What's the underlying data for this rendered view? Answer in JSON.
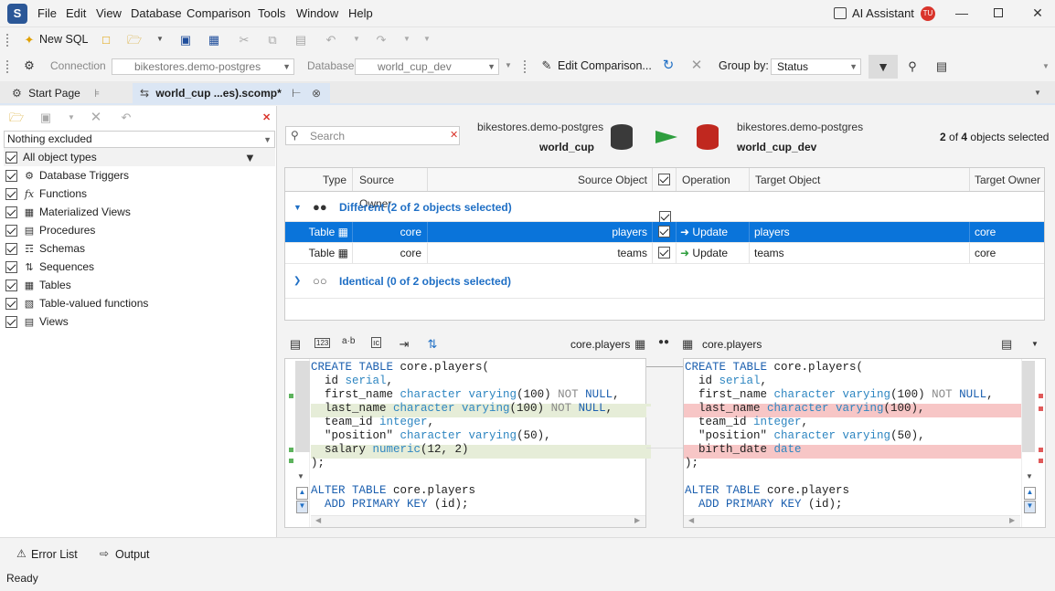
{
  "app": {
    "menu": [
      "File",
      "Edit",
      "View",
      "Database",
      "Comparison",
      "Tools",
      "Window",
      "Help"
    ],
    "ai_assistant": "AI Assistant",
    "user_initials": "TU"
  },
  "toolbar1": {
    "new_sql": "New SQL"
  },
  "toolbar2": {
    "connection_label": "Connection",
    "connection_value": "bikestores.demo-postgres",
    "database_label": "Database",
    "database_value": "world_cup_dev",
    "edit_comparison": "Edit Comparison...",
    "group_by_label": "Group by:",
    "group_by_value": "Status"
  },
  "tabs": [
    {
      "label": "Start Page"
    },
    {
      "label": "world_cup ...es).scomp*"
    }
  ],
  "left_panel": {
    "filter_value": "Nothing excluded",
    "items": [
      {
        "label": "All object types",
        "icon": "all-icon"
      },
      {
        "label": "Database Triggers",
        "icon": "trigger-icon"
      },
      {
        "label": "Functions",
        "icon": "function-icon"
      },
      {
        "label": "Materialized Views",
        "icon": "matview-icon"
      },
      {
        "label": "Procedures",
        "icon": "procedure-icon"
      },
      {
        "label": "Schemas",
        "icon": "schema-icon"
      },
      {
        "label": "Sequences",
        "icon": "sequence-icon"
      },
      {
        "label": "Tables",
        "icon": "table-icon"
      },
      {
        "label": "Table-valued functions",
        "icon": "tvf-icon"
      },
      {
        "label": "Views",
        "icon": "view-icon"
      }
    ]
  },
  "comparison": {
    "search_placeholder": "Search",
    "source_server": "bikestores.demo-postgres",
    "source_db": "world_cup",
    "target_server": "bikestores.demo-postgres",
    "target_db": "world_cup_dev",
    "selected_count": "2",
    "total_count": "4",
    "selected_suffix": "objects selected",
    "selected_of": "of"
  },
  "grid": {
    "columns": [
      "Type",
      "Source Owner",
      "Source Object",
      "Operation",
      "Target Object",
      "Target Owner"
    ],
    "group_different": "Different (2 of 2 objects selected)",
    "group_identical": "Identical (0 of 2 objects selected)",
    "rows": [
      {
        "type": "Table",
        "source_owner": "core",
        "source_object": "players",
        "operation": "Update",
        "target_object": "players",
        "target_owner": "core"
      },
      {
        "type": "Table",
        "source_owner": "core",
        "source_object": "teams",
        "operation": "Update",
        "target_object": "teams",
        "target_owner": "core"
      }
    ]
  },
  "diff": {
    "left_title": "core.players",
    "right_title": "core.players"
  },
  "bottom": {
    "error_list": "Error List",
    "output": "Output",
    "status": "Ready"
  },
  "colors": {
    "selection": "#0a74da",
    "added_bg": "#e6edd8",
    "removed_bg": "#f7c6c6"
  }
}
